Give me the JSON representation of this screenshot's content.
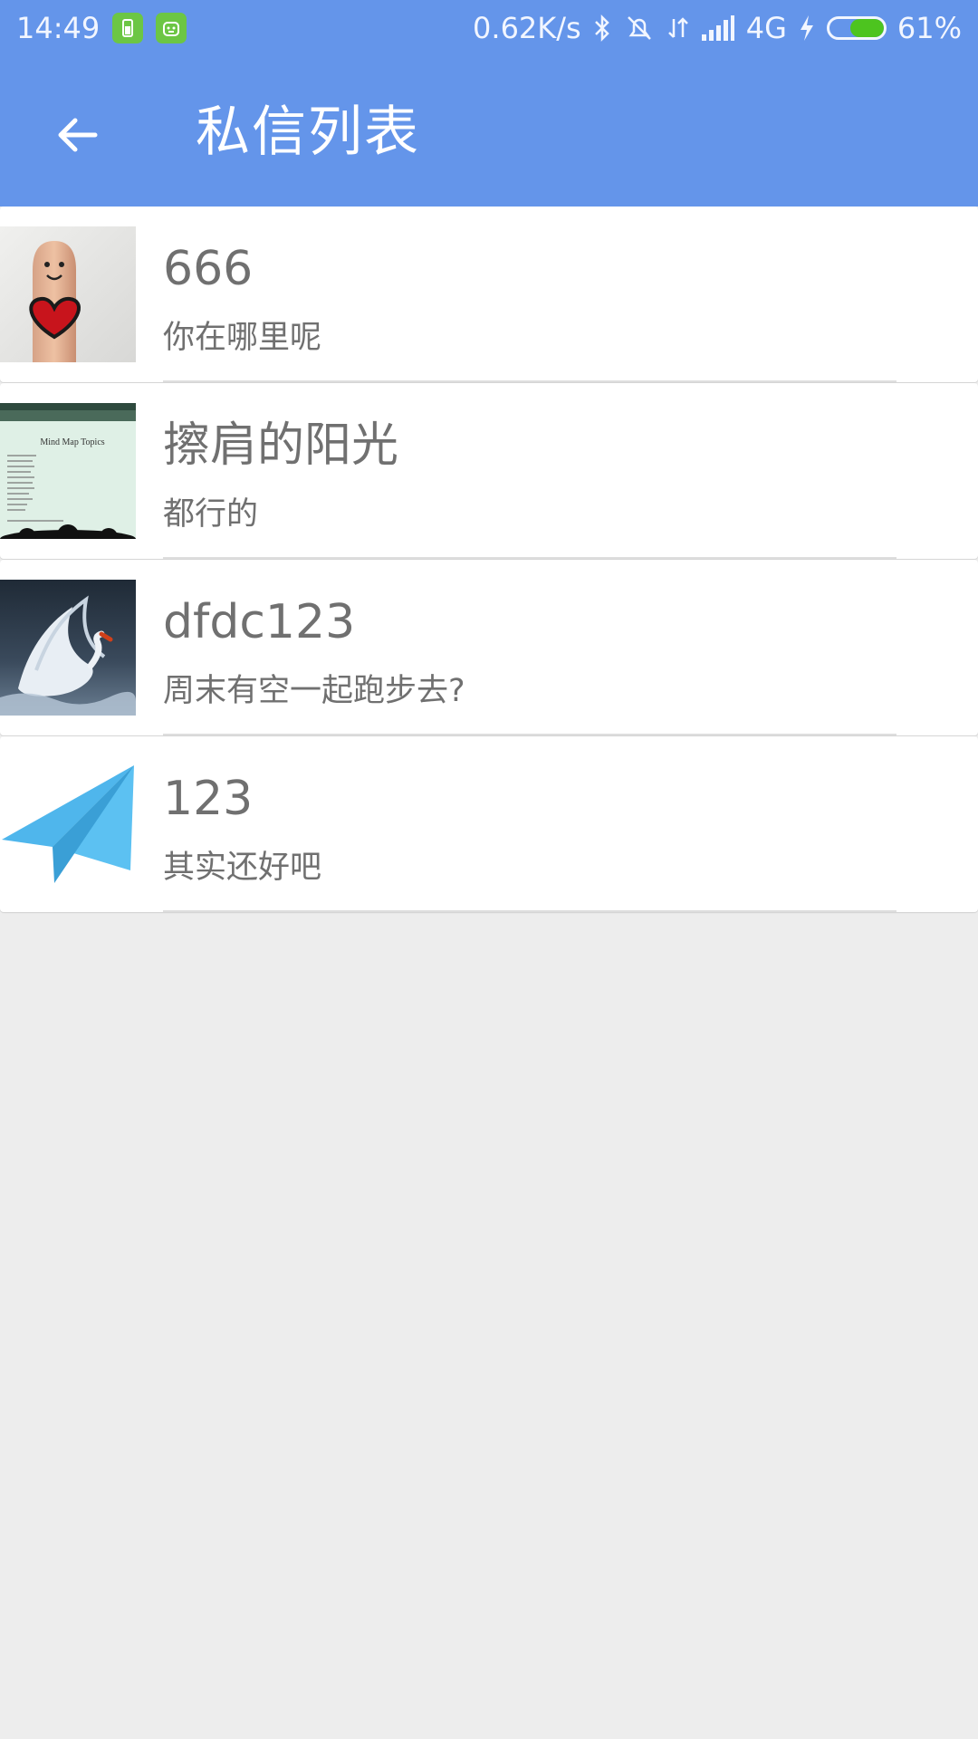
{
  "status_bar": {
    "time": "14:49",
    "net_speed": "0.62K/s",
    "network": "4G",
    "battery_text": "61%",
    "battery_level": 0.61,
    "battery_color": "#4dc41f",
    "icons": [
      "battery-app-icon",
      "android-app-icon",
      "bluetooth-icon",
      "mute-icon",
      "data-arrows-icon",
      "signal-icon",
      "charging-icon"
    ]
  },
  "app_bar": {
    "title": "私信列表",
    "back_icon": "arrow-left-icon",
    "color": "#6495ea"
  },
  "conversations": [
    {
      "name": "666",
      "message": "你在哪里呢",
      "avatar": "finger-heart-photo"
    },
    {
      "name": "擦肩的阳光",
      "message": "都行的",
      "avatar": "mind-map-slide-photo",
      "avatar_text": "Mind Map Topics"
    },
    {
      "name": "dfdc123",
      "message": "周末有空一起跑步去?",
      "avatar": "swan-photo"
    },
    {
      "name": "123",
      "message": "其实还好吧",
      "avatar": "paper-plane-icon"
    }
  ]
}
